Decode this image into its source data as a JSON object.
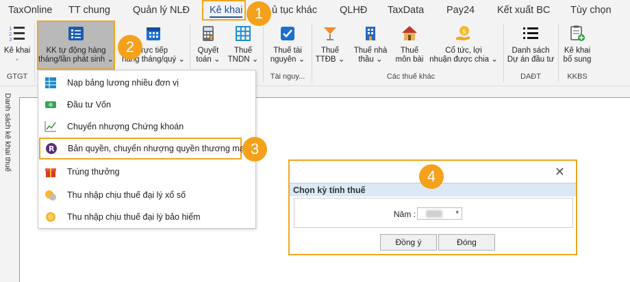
{
  "menu": {
    "items": [
      {
        "label": "TaxOnline"
      },
      {
        "label": "TT chung"
      },
      {
        "label": "Quản lý NLĐ"
      },
      {
        "label": "Kê khai"
      },
      {
        "label": "ủ tục khác"
      },
      {
        "label": "QLHĐ"
      },
      {
        "label": "TaxData"
      },
      {
        "label": "Pay24"
      },
      {
        "label": "Kết xuất BC"
      },
      {
        "label": "Tùy chọn"
      }
    ]
  },
  "ribbon": {
    "buttons": [
      {
        "line1": "Kê khai",
        "line2": "",
        "caret": "⌄",
        "icon": "list-numbered-icon"
      },
      {
        "line1": "KK tự động hàng",
        "line2": "tháng/lần phát sinh ⌄",
        "caret": "",
        "icon": "auto-declare-icon"
      },
      {
        "line1": "trực tiếp",
        "line2": "hàng tháng/quý ⌄",
        "caret": "",
        "icon": "calendar-icon"
      },
      {
        "line1": "Quyết",
        "line2": "toán ⌄",
        "caret": "",
        "icon": "calculator-icon"
      },
      {
        "line1": "Thuế",
        "line2": "TNDN ⌄",
        "caret": "",
        "icon": "grid-icon"
      },
      {
        "line1": "Thuế tài",
        "line2": "nguyên ⌄",
        "caret": "",
        "icon": "checkbox-icon"
      },
      {
        "line1": "Thuế",
        "line2": "TTĐB ⌄",
        "caret": "",
        "icon": "cocktail-icon"
      },
      {
        "line1": "Thuế nhà",
        "line2": "thầu ⌄",
        "caret": "",
        "icon": "building-icon"
      },
      {
        "line1": "Thuế",
        "line2": "môn bài",
        "caret": "",
        "icon": "house-icon"
      },
      {
        "line1": "Cổ tức, lợi",
        "line2": "nhuận được chia ⌄",
        "caret": "",
        "icon": "coin-hand-icon"
      },
      {
        "line1": "Danh sách",
        "line2": "Dự án đầu tư",
        "caret": "",
        "icon": "bullet-list-icon"
      },
      {
        "line1": "Kê khai",
        "line2": "bổ sung",
        "caret": "",
        "icon": "clipboard-add-icon"
      }
    ],
    "groups": [
      "GTGT",
      "Tài nguy...",
      "Các thuế khác",
      "DAĐT",
      "KKBS"
    ]
  },
  "sidebar": {
    "label": "Danh sách kê khai thuế"
  },
  "dropdown": {
    "items": [
      {
        "label": "Nạp bảng lương nhiều đơn vị",
        "icon": "spreadsheet-icon"
      },
      {
        "label": "Đầu tư Vốn",
        "icon": "money-icon"
      },
      {
        "label": "Chuyển nhượng Chứng khoán",
        "icon": "stock-chart-icon"
      },
      {
        "label": "Bản quyền, chuyển nhượng quyền thương mại",
        "icon": "registered-icon"
      },
      {
        "label": "Trúng thưởng",
        "icon": "gift-icon"
      },
      {
        "label": "Thu nhập chịu thuế đại lý xổ số",
        "icon": "lottery-coin-icon"
      },
      {
        "label": "Thu nhập chịu thuế đại lý bảo hiểm",
        "icon": "insurance-coin-icon"
      }
    ]
  },
  "dialog": {
    "title": "Chọn kỳ tính thuế",
    "close": "✕",
    "year_label": "Năm :",
    "ok": "Đồng ý",
    "cancel": "Đóng"
  },
  "callouts": [
    "1",
    "2",
    "3",
    "4"
  ],
  "colors": {
    "accent": "#f0a51e",
    "badge": "#f5a11c",
    "link": "#1f4e99",
    "title_bar": "#dbe8f6"
  }
}
